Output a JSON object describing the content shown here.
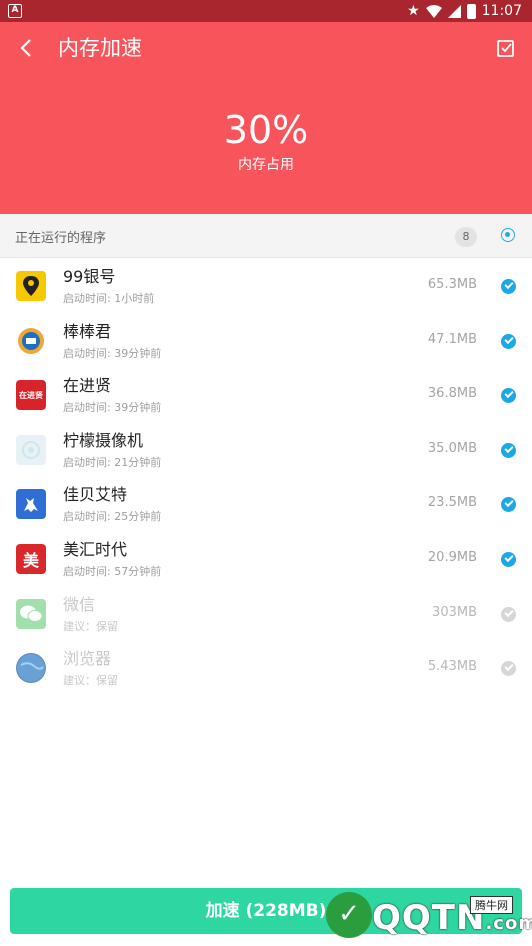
{
  "status_bar": {
    "notification_glyph": "A",
    "time": "11:07"
  },
  "header": {
    "title": "内存加速",
    "percent": "30%",
    "label": "内存占用"
  },
  "section": {
    "label": "正在运行的程序",
    "count": "8"
  },
  "apps": [
    {
      "name": "99银号",
      "sub": "启动时间: 1小时前",
      "size": "65.3MB",
      "checked": true,
      "icon": "map-pin-icon",
      "color": "#f5c800"
    },
    {
      "name": "棒棒君",
      "sub": "启动时间: 39分钟前",
      "size": "47.1MB",
      "checked": true,
      "icon": "bangbangjun-icon",
      "color": "#1f6fbf"
    },
    {
      "name": "在进贤",
      "sub": "启动时间: 39分钟前",
      "size": "36.8MB",
      "checked": true,
      "icon": "zaijinxian-icon",
      "color": "#d9232a",
      "icon_text": "在进贤"
    },
    {
      "name": "柠檬摄像机",
      "sub": "启动时间: 21分钟前",
      "size": "35.0MB",
      "checked": true,
      "icon": "camera-icon",
      "color": "#e8f2f6"
    },
    {
      "name": "佳贝艾特",
      "sub": "启动时间: 25分钟前",
      "size": "23.5MB",
      "checked": true,
      "icon": "goat-icon",
      "color": "#2f6ed4"
    },
    {
      "name": "美汇时代",
      "sub": "启动时间: 57分钟前",
      "size": "20.9MB",
      "checked": true,
      "icon": "meihui-icon",
      "color": "#d8282c",
      "icon_text": "美"
    },
    {
      "name": "微信",
      "sub": "建议：保留",
      "size": "303MB",
      "checked": false,
      "icon": "wechat-icon",
      "color": "#46c25a"
    },
    {
      "name": "浏览器",
      "sub": "建议：保留",
      "size": "5.43MB",
      "checked": false,
      "icon": "globe-icon",
      "color": "#1d5a9a"
    }
  ],
  "button": {
    "label": "加速 (228MB)"
  },
  "watermark": {
    "logo_text": "✓",
    "text": "QQTN",
    "domain": ".com",
    "badge": "腾牛网"
  },
  "colors": {
    "header": "#f8545c",
    "statusbar": "#a9262f",
    "accent": "#1aa8e8",
    "button": "#2ed7a2"
  }
}
